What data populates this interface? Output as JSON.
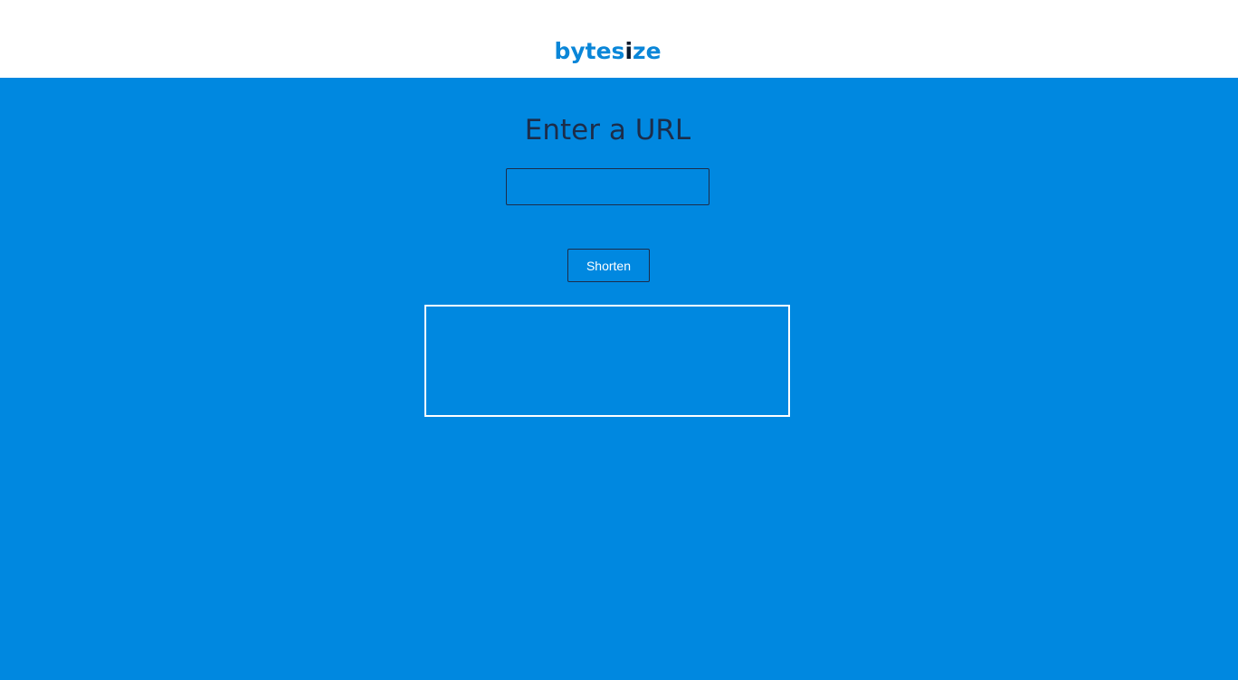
{
  "header": {
    "logo_prefix": "bytes",
    "logo_accent": "i",
    "logo_suffix": "ze"
  },
  "main": {
    "heading": "Enter a URL",
    "url_input": {
      "value": "",
      "placeholder": ""
    },
    "shorten_label": "Shorten",
    "result_text": ""
  },
  "colors": {
    "brand_blue": "#0a86d8",
    "background_blue": "#0088e0",
    "dark_navy": "#1c2d4a",
    "white": "#ffffff"
  }
}
